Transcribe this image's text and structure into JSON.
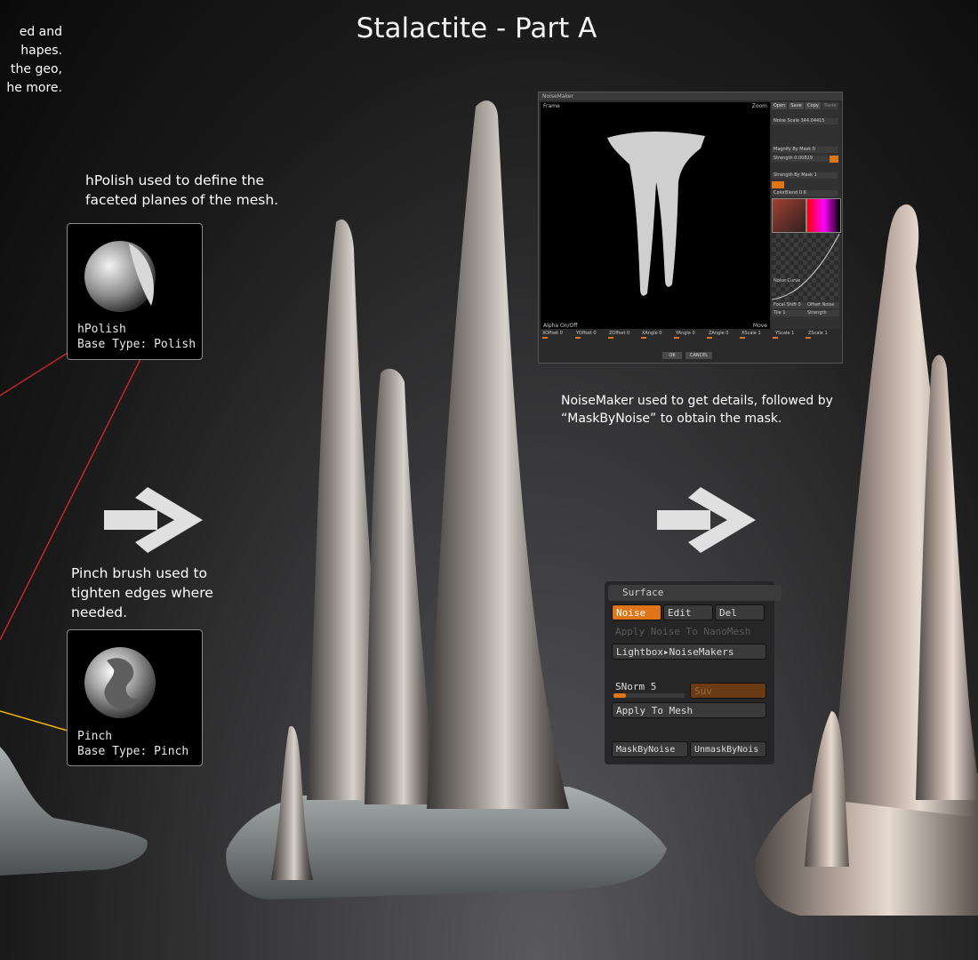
{
  "title": "Stalactite - Part A",
  "left_caption_lines": [
    "ed and",
    "hapes.",
    "the geo,",
    "he more."
  ],
  "hpolish_caption": [
    "hPolish used to define the",
    "faceted planes of the mesh."
  ],
  "pinch_caption": [
    "Pinch brush used to",
    "tighten edges where",
    "needed."
  ],
  "hpolish_card": {
    "name": "hPolish",
    "base_type": "Base Type: Polish"
  },
  "pinch_card": {
    "name": "Pinch",
    "base_type": "Base Type: Pinch"
  },
  "noisemaker_caption": [
    "NoiseMaker used to get details, followed by",
    "“MaskByNoise” to obtain the mask."
  ],
  "noisemaker_window": {
    "title": "NoiseMaker",
    "frame_label": "Frame",
    "zoom_label": "Zoom",
    "buttons": [
      "Open",
      "Save",
      "Copy",
      "Paste"
    ],
    "noise_scale": "Noise Scale 344.04415",
    "magnify": "Magnify By Mask 0",
    "strength": "Strength 0.00829",
    "strength_by_mask": "Strength By Mask 1",
    "color_blend": "ColorBlend 0.6",
    "noise_curve": "Noise Curve",
    "focal_shift": "Focal Shift 0",
    "offset_noise": "Offset Noise",
    "tile": "Tile 1",
    "strength2": "Strength",
    "alpha": "Alpha On/Off",
    "move": "Move",
    "offsets": [
      "XOffset 0",
      "YOffset 0",
      "ZOffset 0",
      "XAngle 0",
      "YAngle 0",
      "ZAngle 0",
      "XScale 1",
      "YScale 1",
      "ZScale 1"
    ],
    "ok": "OK",
    "cancel": "CANCEL"
  },
  "surface_panel": {
    "header": "Surface",
    "noise": "Noise",
    "edit": "Edit",
    "del": "Del",
    "apply_nanomesh": "Apply Noise To NanoMesh",
    "lightbox": "Lightbox▸NoiseMakers",
    "snorm": "SNorm 5",
    "suv": "Suv",
    "apply_mesh": "Apply To Mesh",
    "mask_by_noise": "MaskByNoise",
    "unmask_by_noise": "UnmaskByNois"
  },
  "colors": {
    "accent": "#e07518",
    "red_line": "#c0262b",
    "yellow_line": "#f0b400"
  }
}
